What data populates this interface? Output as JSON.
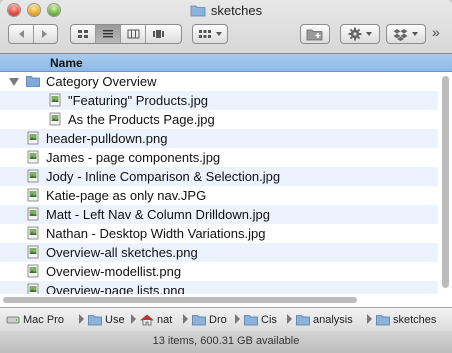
{
  "window": {
    "title": "sketches"
  },
  "toolbar": {
    "back_icon": "chevron-left-icon",
    "forward_icon": "chevron-right-icon",
    "views": [
      "icon-view-icon",
      "list-view-icon",
      "column-view-icon",
      "coverflow-view-icon"
    ],
    "active_view": "list-view-icon",
    "arrange_icon": "arrange-grid-icon",
    "new_folder_icon": "new-folder-icon",
    "action_icon": "gear-icon",
    "dropbox_icon": "dropbox-icon",
    "overflow": "»"
  },
  "list": {
    "header": "Name",
    "rows": [
      {
        "label": "Category Overview",
        "kind": "folder",
        "indent": 0,
        "expanded": true
      },
      {
        "label": "\"Featuring\" Products.jpg",
        "kind": "image",
        "indent": 1
      },
      {
        "label": "As the Products Page.jpg",
        "kind": "image",
        "indent": 1
      },
      {
        "label": "header-pulldown.png",
        "kind": "image",
        "indent": 0
      },
      {
        "label": "James - page components.jpg",
        "kind": "image",
        "indent": 0
      },
      {
        "label": "Jody - Inline Comparison & Selection.jpg",
        "kind": "image",
        "indent": 0
      },
      {
        "label": "Katie-page as only nav.JPG",
        "kind": "image",
        "indent": 0
      },
      {
        "label": "Matt - Left Nav & Column Drilldown.jpg",
        "kind": "image",
        "indent": 0
      },
      {
        "label": "Nathan - Desktop Width Variations.jpg",
        "kind": "image",
        "indent": 0
      },
      {
        "label": "Overview-all sketches.png",
        "kind": "image",
        "indent": 0
      },
      {
        "label": "Overview-modellist.png",
        "kind": "image",
        "indent": 0
      },
      {
        "label": "Overview-page lists.png",
        "kind": "image",
        "indent": 0
      }
    ]
  },
  "pathbar": {
    "items": [
      {
        "label": "Mac Pro",
        "icon": "hard-drive-icon"
      },
      {
        "label": "Use",
        "icon": "folder-icon"
      },
      {
        "label": "nat",
        "icon": "home-icon"
      },
      {
        "label": "Dro",
        "icon": "folder-icon"
      },
      {
        "label": "Cis",
        "icon": "folder-icon"
      },
      {
        "label": "analysis",
        "icon": "folder-icon"
      },
      {
        "label": "sketches",
        "icon": "folder-icon"
      }
    ]
  },
  "status": {
    "text": "13 items, 600.31 GB available"
  },
  "colors": {
    "header_blue": "#9ec3eb",
    "alt_row": "#edf3fe",
    "folder_blue": "#7fa9d6"
  }
}
